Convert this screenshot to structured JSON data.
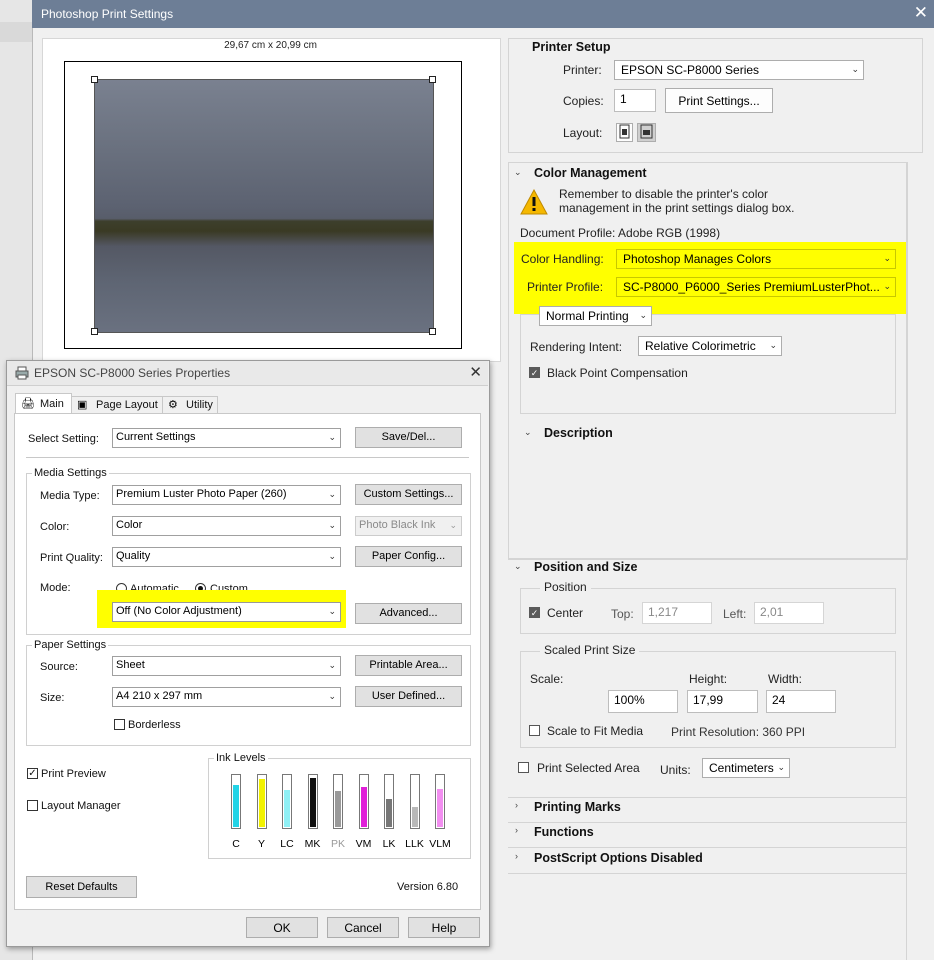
{
  "ps": {
    "title": "Photoshop Print Settings",
    "close": "✕",
    "paper_dims": "29,67 cm x 20,99 cm",
    "printer_setup": {
      "header": "Printer Setup",
      "printer_label": "Printer:",
      "printer_value": "EPSON SC-P8000 Series",
      "copies_label": "Copies:",
      "copies_value": "1",
      "print_settings_btn": "Print Settings...",
      "layout_label": "Layout:"
    },
    "color_management": {
      "header": "Color Management",
      "warning": "Remember to disable the printer's color management in the print settings dialog box.",
      "doc_profile": "Document Profile: Adobe RGB (1998)",
      "handling_label": "Color Handling:",
      "handling_value": "Photoshop Manages Colors",
      "profile_label": "Printer Profile:",
      "profile_value": "SC-P8000_P6000_Series PremiumLusterPhot...",
      "normal_printing": "Normal Printing",
      "intent_label": "Rendering Intent:",
      "intent_value": "Relative Colorimetric",
      "bpc_label": "Black Point Compensation"
    },
    "description": {
      "header": "Description"
    },
    "position_size": {
      "header": "Position and Size",
      "position_label": "Position",
      "center_label": "Center",
      "top_label": "Top:",
      "top_value": "1,217",
      "left_label": "Left:",
      "left_value": "2,01",
      "scaled_label": "Scaled Print Size",
      "scale_label": "Scale:",
      "height_label": "Height:",
      "width_label": "Width:",
      "scale_value": "100%",
      "height_value": "17,99",
      "width_value": "24",
      "fit_label": "Scale to Fit Media",
      "resolution": "Print Resolution: 360 PPI",
      "print_selected": "Print Selected Area",
      "units_label": "Units:",
      "units_value": "Centimeters"
    },
    "sections": [
      "Printing Marks",
      "Functions",
      "PostScript Options Disabled"
    ]
  },
  "epson": {
    "title": "EPSON SC-P8000 Series Properties",
    "tabs": [
      "Main",
      "Page Layout",
      "Utility"
    ],
    "select_setting_label": "Select Setting:",
    "select_setting_value": "Current Settings",
    "save_del": "Save/Del...",
    "media_settings": "Media Settings",
    "media_type_label": "Media Type:",
    "media_type_value": "Premium Luster Photo Paper (260)",
    "custom_settings": "Custom Settings...",
    "color_label": "Color:",
    "color_value": "Color",
    "ink_value": "Photo Black Ink",
    "print_quality_label": "Print Quality:",
    "print_quality_value": "Quality",
    "paper_config": "Paper Config...",
    "mode_label": "Mode:",
    "mode_auto": "Automatic",
    "mode_custom": "Custom",
    "mode_value": "Off (No Color Adjustment)",
    "advanced": "Advanced...",
    "paper_settings": "Paper Settings",
    "source_label": "Source:",
    "source_value": "Sheet",
    "printable_area": "Printable Area...",
    "size_label": "Size:",
    "size_value": "A4 210 x 297 mm",
    "user_defined": "User Defined...",
    "borderless": "Borderless",
    "print_preview": "Print Preview",
    "layout_manager": "Layout Manager",
    "ink_levels": "Ink Levels",
    "inks": [
      {
        "name": "C",
        "color": "#22d3e6",
        "level": 0.82
      },
      {
        "name": "Y",
        "color": "#f2f200",
        "level": 0.95
      },
      {
        "name": "LC",
        "color": "#8ff0f5",
        "level": 0.72
      },
      {
        "name": "MK",
        "color": "#111111",
        "level": 0.97
      },
      {
        "name": "PK",
        "color": "#9a9a9a",
        "level": 0.7
      },
      {
        "name": "VM",
        "color": "#e01fd8",
        "level": 0.78
      },
      {
        "name": "LK",
        "color": "#777777",
        "level": 0.55
      },
      {
        "name": "LLK",
        "color": "#b8b8b8",
        "level": 0.4
      },
      {
        "name": "VLM",
        "color": "#f28ef0",
        "level": 0.74
      }
    ],
    "reset_defaults": "Reset Defaults",
    "version": "Version 6.80",
    "ok": "OK",
    "cancel": "Cancel",
    "help": "Help"
  }
}
